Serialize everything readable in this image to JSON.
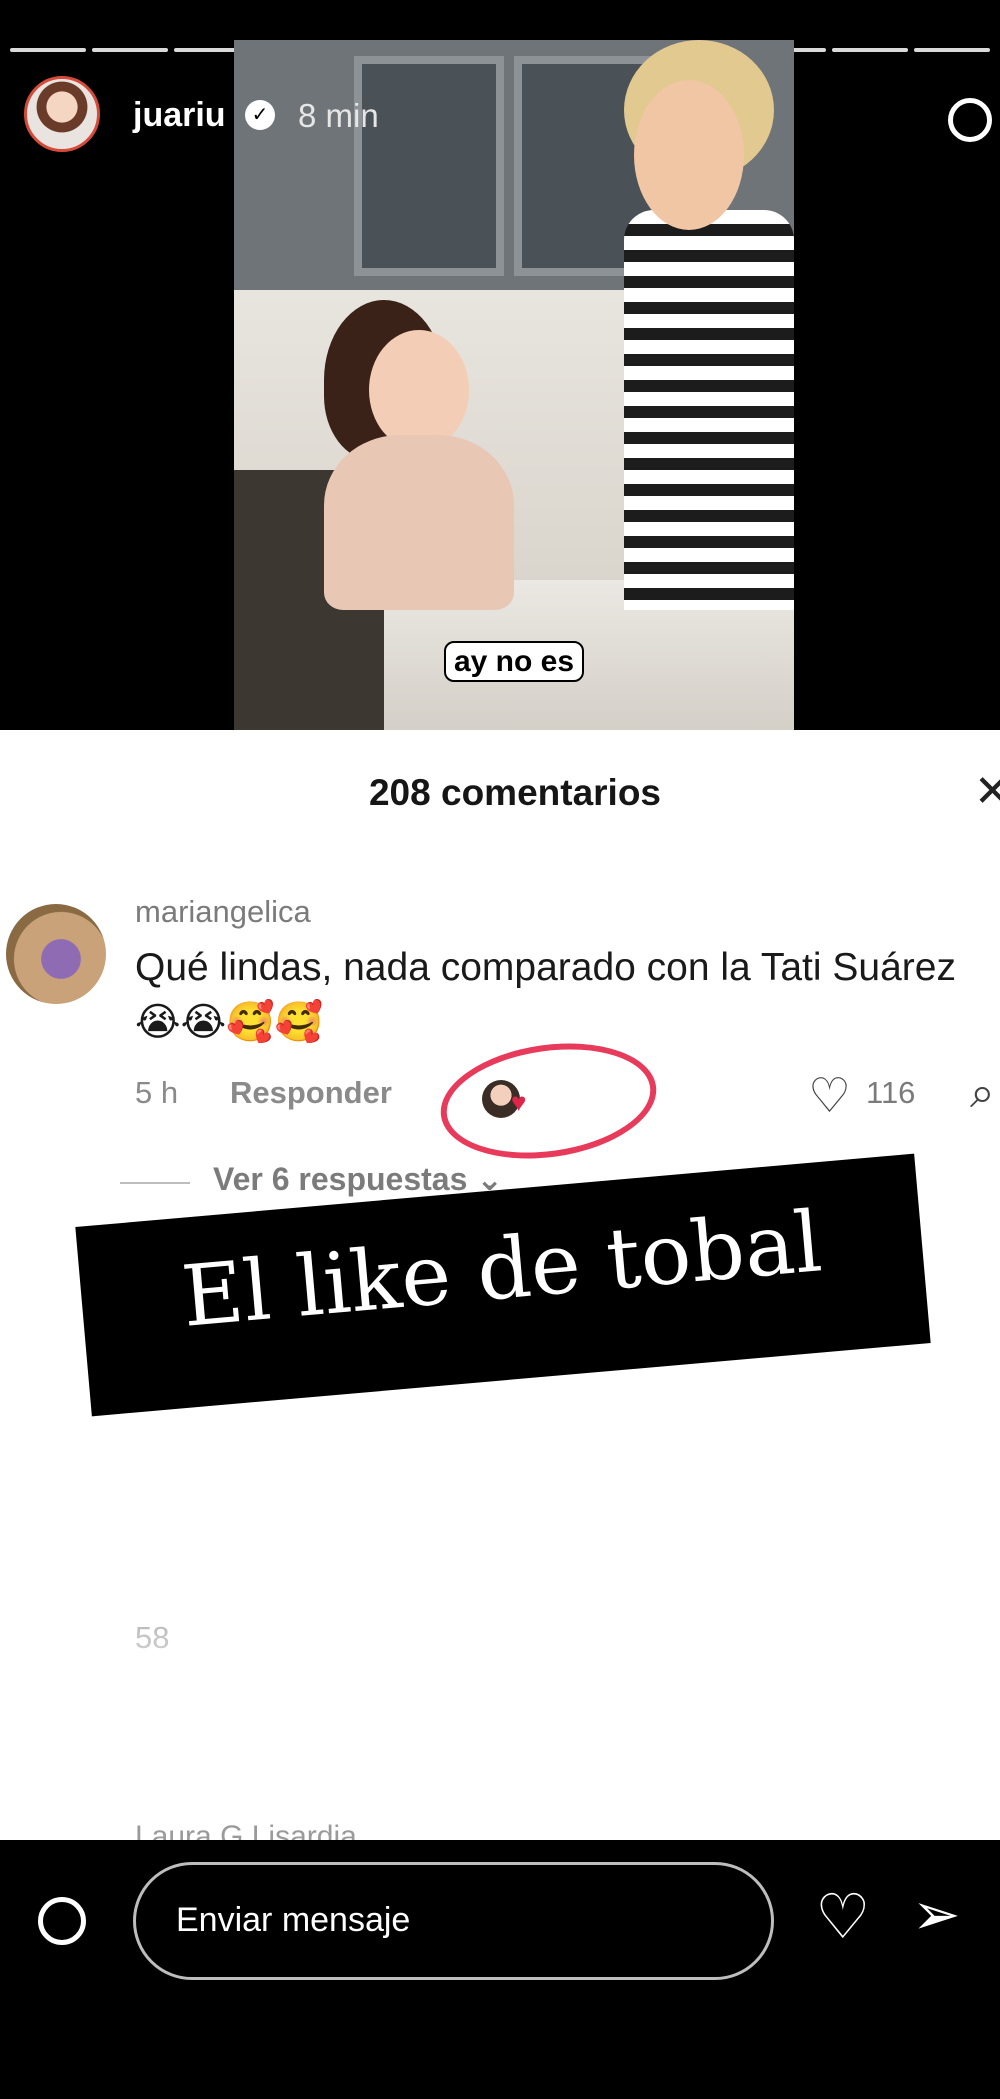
{
  "story": {
    "username": "juariu",
    "time": "8 min",
    "verified_icon": "verified-badge-icon"
  },
  "video": {
    "caption": "ay no es"
  },
  "comments_sheet": {
    "title": "208 comentarios",
    "comment": {
      "username": "mariangelica",
      "text": "Qué lindas, nada comparado con la Tati Suárez 😭😭🥰🥰",
      "age": "5 h",
      "reply_label": "Responder",
      "like_count": "116",
      "view_replies": "Ver 6 respuestas"
    },
    "partial_meta": "58",
    "next_commenter_partial": "Laura G Lisardia"
  },
  "overlay": {
    "banner_text": "El like de tobal",
    "highlight_color": "#e83a5a"
  },
  "footer": {
    "message_placeholder": "Enviar mensaje"
  }
}
